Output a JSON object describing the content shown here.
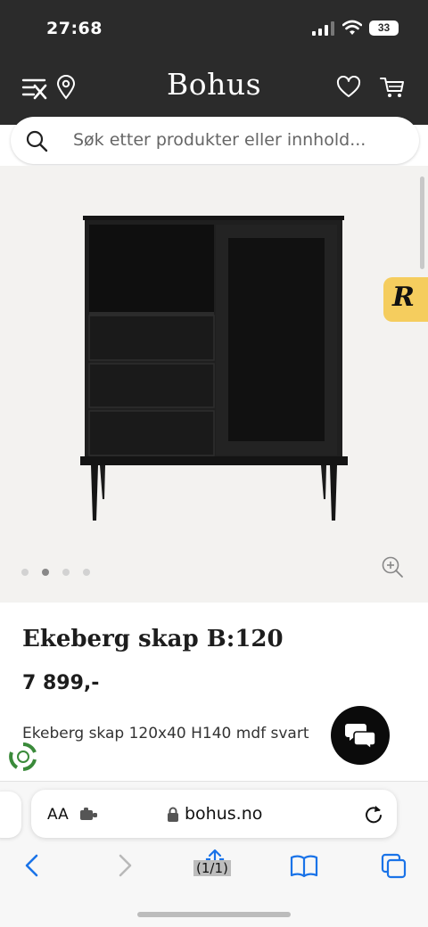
{
  "status_bar": {
    "time": "27:68",
    "battery": "33"
  },
  "header": {
    "logo": "Bohus"
  },
  "search": {
    "placeholder": "Søk etter produkter eller innhold..."
  },
  "gallery": {
    "slide_count": 4,
    "active_slide": 2
  },
  "badge": {
    "letter": "R"
  },
  "product": {
    "name": "Ekeberg skap B:120",
    "price": "7 899,-",
    "description": "Ekeberg skap 120x40 H140 mdf svart"
  },
  "browser": {
    "text_size_label": "AA",
    "url": "bohus.no",
    "tab_count": "(1/1)"
  },
  "colors": {
    "header_bg": "#2b2b2b",
    "gallery_bg": "#f3f2f0",
    "badge_bg": "#f5cd5e",
    "link_blue": "#1a73e8"
  }
}
